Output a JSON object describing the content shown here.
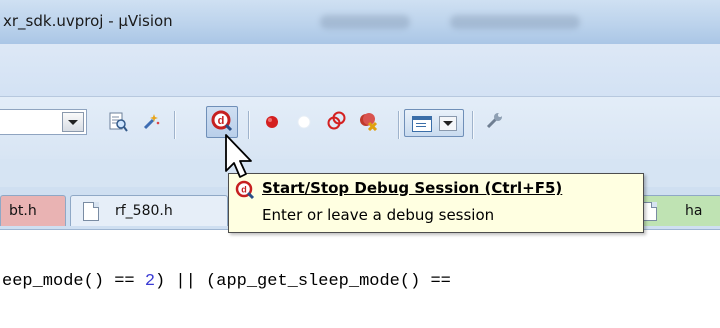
{
  "window": {
    "title": "xr_sdk.uvproj - µVision"
  },
  "toolbar": {
    "target_select_value": "",
    "debug_button_icon": "start-stop-debug-icon"
  },
  "tabs": [
    {
      "label": "bt.h",
      "color": "#e9b3b3"
    },
    {
      "label": "rf_580.h",
      "color": "#e6eef8"
    },
    {
      "label": "",
      "color": "#b7cdea"
    },
    {
      "label": "",
      "color": "#b7cdea"
    },
    {
      "label": "ha",
      "color": "#bfe3b3"
    }
  ],
  "tooltip": {
    "title": "Start/Stop Debug Session (Ctrl+F5)",
    "description": "Enter or leave a debug session"
  },
  "editor": {
    "code_part1": "eep_mode() == ",
    "code_num1": "2",
    "code_part2": ") || (app_get_sleep_mode() =="
  },
  "colors": {
    "debug_red": "#d42020",
    "tooltip_bg": "#ffffe1",
    "accent": "#3b6ea8"
  }
}
